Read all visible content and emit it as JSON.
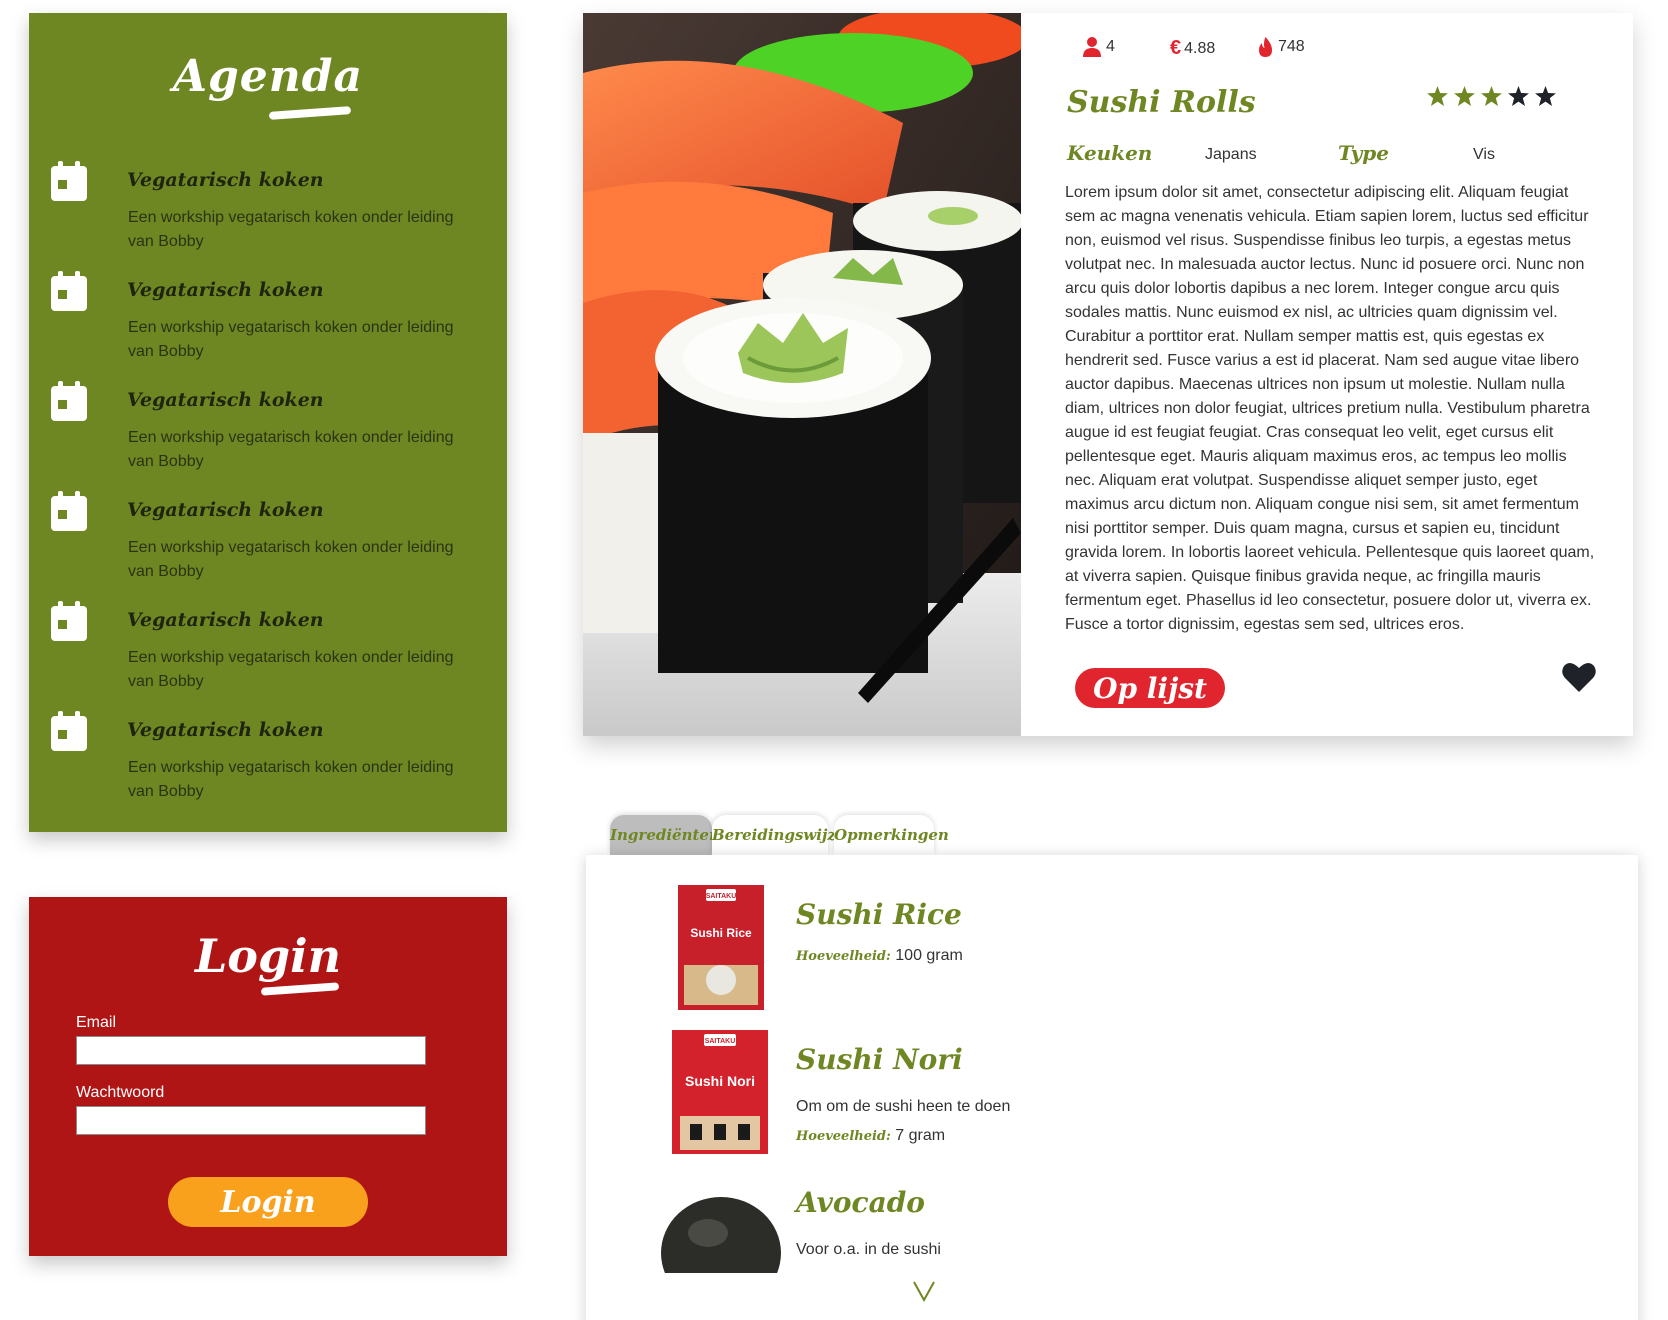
{
  "agenda": {
    "title": "Agenda",
    "items": [
      {
        "title": "Vegatarisch koken",
        "description": "Een workship vegatarisch koken onder leiding van Bobby"
      },
      {
        "title": "Vegatarisch koken",
        "description": "Een workship vegatarisch koken onder leiding van Bobby"
      },
      {
        "title": "Vegatarisch koken",
        "description": "Een workship vegatarisch koken onder leiding van Bobby"
      },
      {
        "title": "Vegatarisch koken",
        "description": "Een workship vegatarisch koken onder leiding van Bobby"
      },
      {
        "title": "Vegatarisch koken",
        "description": "Een workship vegatarisch koken onder leiding van Bobby"
      },
      {
        "title": "Vegatarisch koken",
        "description": "Een workship vegatarisch koken onder leiding van Bobby"
      }
    ]
  },
  "login": {
    "title": "Login",
    "email_label": "Email",
    "email_value": "",
    "password_label": "Wachtwoord",
    "password_value": "",
    "button_label": "Login"
  },
  "recipe": {
    "persons": "4",
    "price": "4.88",
    "calories": "748",
    "title": "Sushi Rolls",
    "rating": 3,
    "rating_max": 5,
    "kitchen_label": "Keuken",
    "kitchen_value": "Japans",
    "type_label": "Type",
    "type_value": "Vis",
    "description": "Lorem ipsum dolor sit amet, consectetur adipiscing elit. Aliquam feugiat sem ac magna venenatis vehicula. Etiam sapien lorem, luctus sed efficitur non, euismod vel risus. Suspendisse finibus leo turpis, a egestas metus volutpat nec. In malesuada auctor lectus. Nunc id posuere orci. Nunc non arcu quis dolor lobortis dapibus a nec lorem. Integer congue arcu quis sodales mattis. Nunc euismod ex nisl, ac ultricies quam dignissim vel. Curabitur a porttitor erat. Nullam semper mattis est, quis egestas ex hendrerit sed. Fusce varius a est id placerat. Nam sed augue vitae libero auctor dapibus. Maecenas ultrices non ipsum ut molestie. Nullam nulla diam, ultrices non dolor feugiat, ultrices pretium nulla. Vestibulum pharetra augue id est feugiat feugiat. Cras consequat leo velit, eget cursus elit pellentesque eget. Mauris aliquam maximus eros, ac tempus leo mollis nec. Aliquam erat volutpat. Suspendisse aliquet semper justo, eget maximus arcu dictum non. Aliquam congue nisi sem, sit amet fermentum nisi porttitor semper. Duis quam magna, cursus et sapien eu, tincidunt gravida lorem. In lobortis laoreet vehicula. Pellentesque quis laoreet quam, at viverra sapien. Quisque finibus gravida neque, ac fringilla mauris fermentum eget. Phasellus id leo consectetur, posuere dolor ut, viverra ex. Fusce a tortor dignissim, egestas sem sed, ultrices eros.",
    "list_button": "Op lijst",
    "image_icon": "sushi-photo",
    "colors": {
      "green": "#6e8722",
      "red": "#e0252f"
    }
  },
  "tabs": [
    {
      "label": "Ingrediënten",
      "active": true
    },
    {
      "label": "Bereidingswijze",
      "active": false
    },
    {
      "label": "Opmerkingen",
      "active": false
    }
  ],
  "ingredients": {
    "quantity_label": "Hoeveelheid:",
    "items": [
      {
        "name": "Sushi Rice",
        "description": "",
        "quantity": "100 gram",
        "brand": "SAITAKU",
        "pack_text": "Sushi Rice"
      },
      {
        "name": "Sushi Nori",
        "description": "Om om de sushi heen te doen",
        "quantity": "7 gram",
        "brand": "SAITAKU",
        "pack_text": "Sushi Nori"
      },
      {
        "name": "Avocado",
        "description": "Voor o.a. in de sushi",
        "quantity": "",
        "brand": "",
        "pack_text": ""
      }
    ]
  },
  "colors": {
    "agenda_bg": "#6e8722",
    "login_bg": "#b01515",
    "login_button": "#f9a01c"
  }
}
